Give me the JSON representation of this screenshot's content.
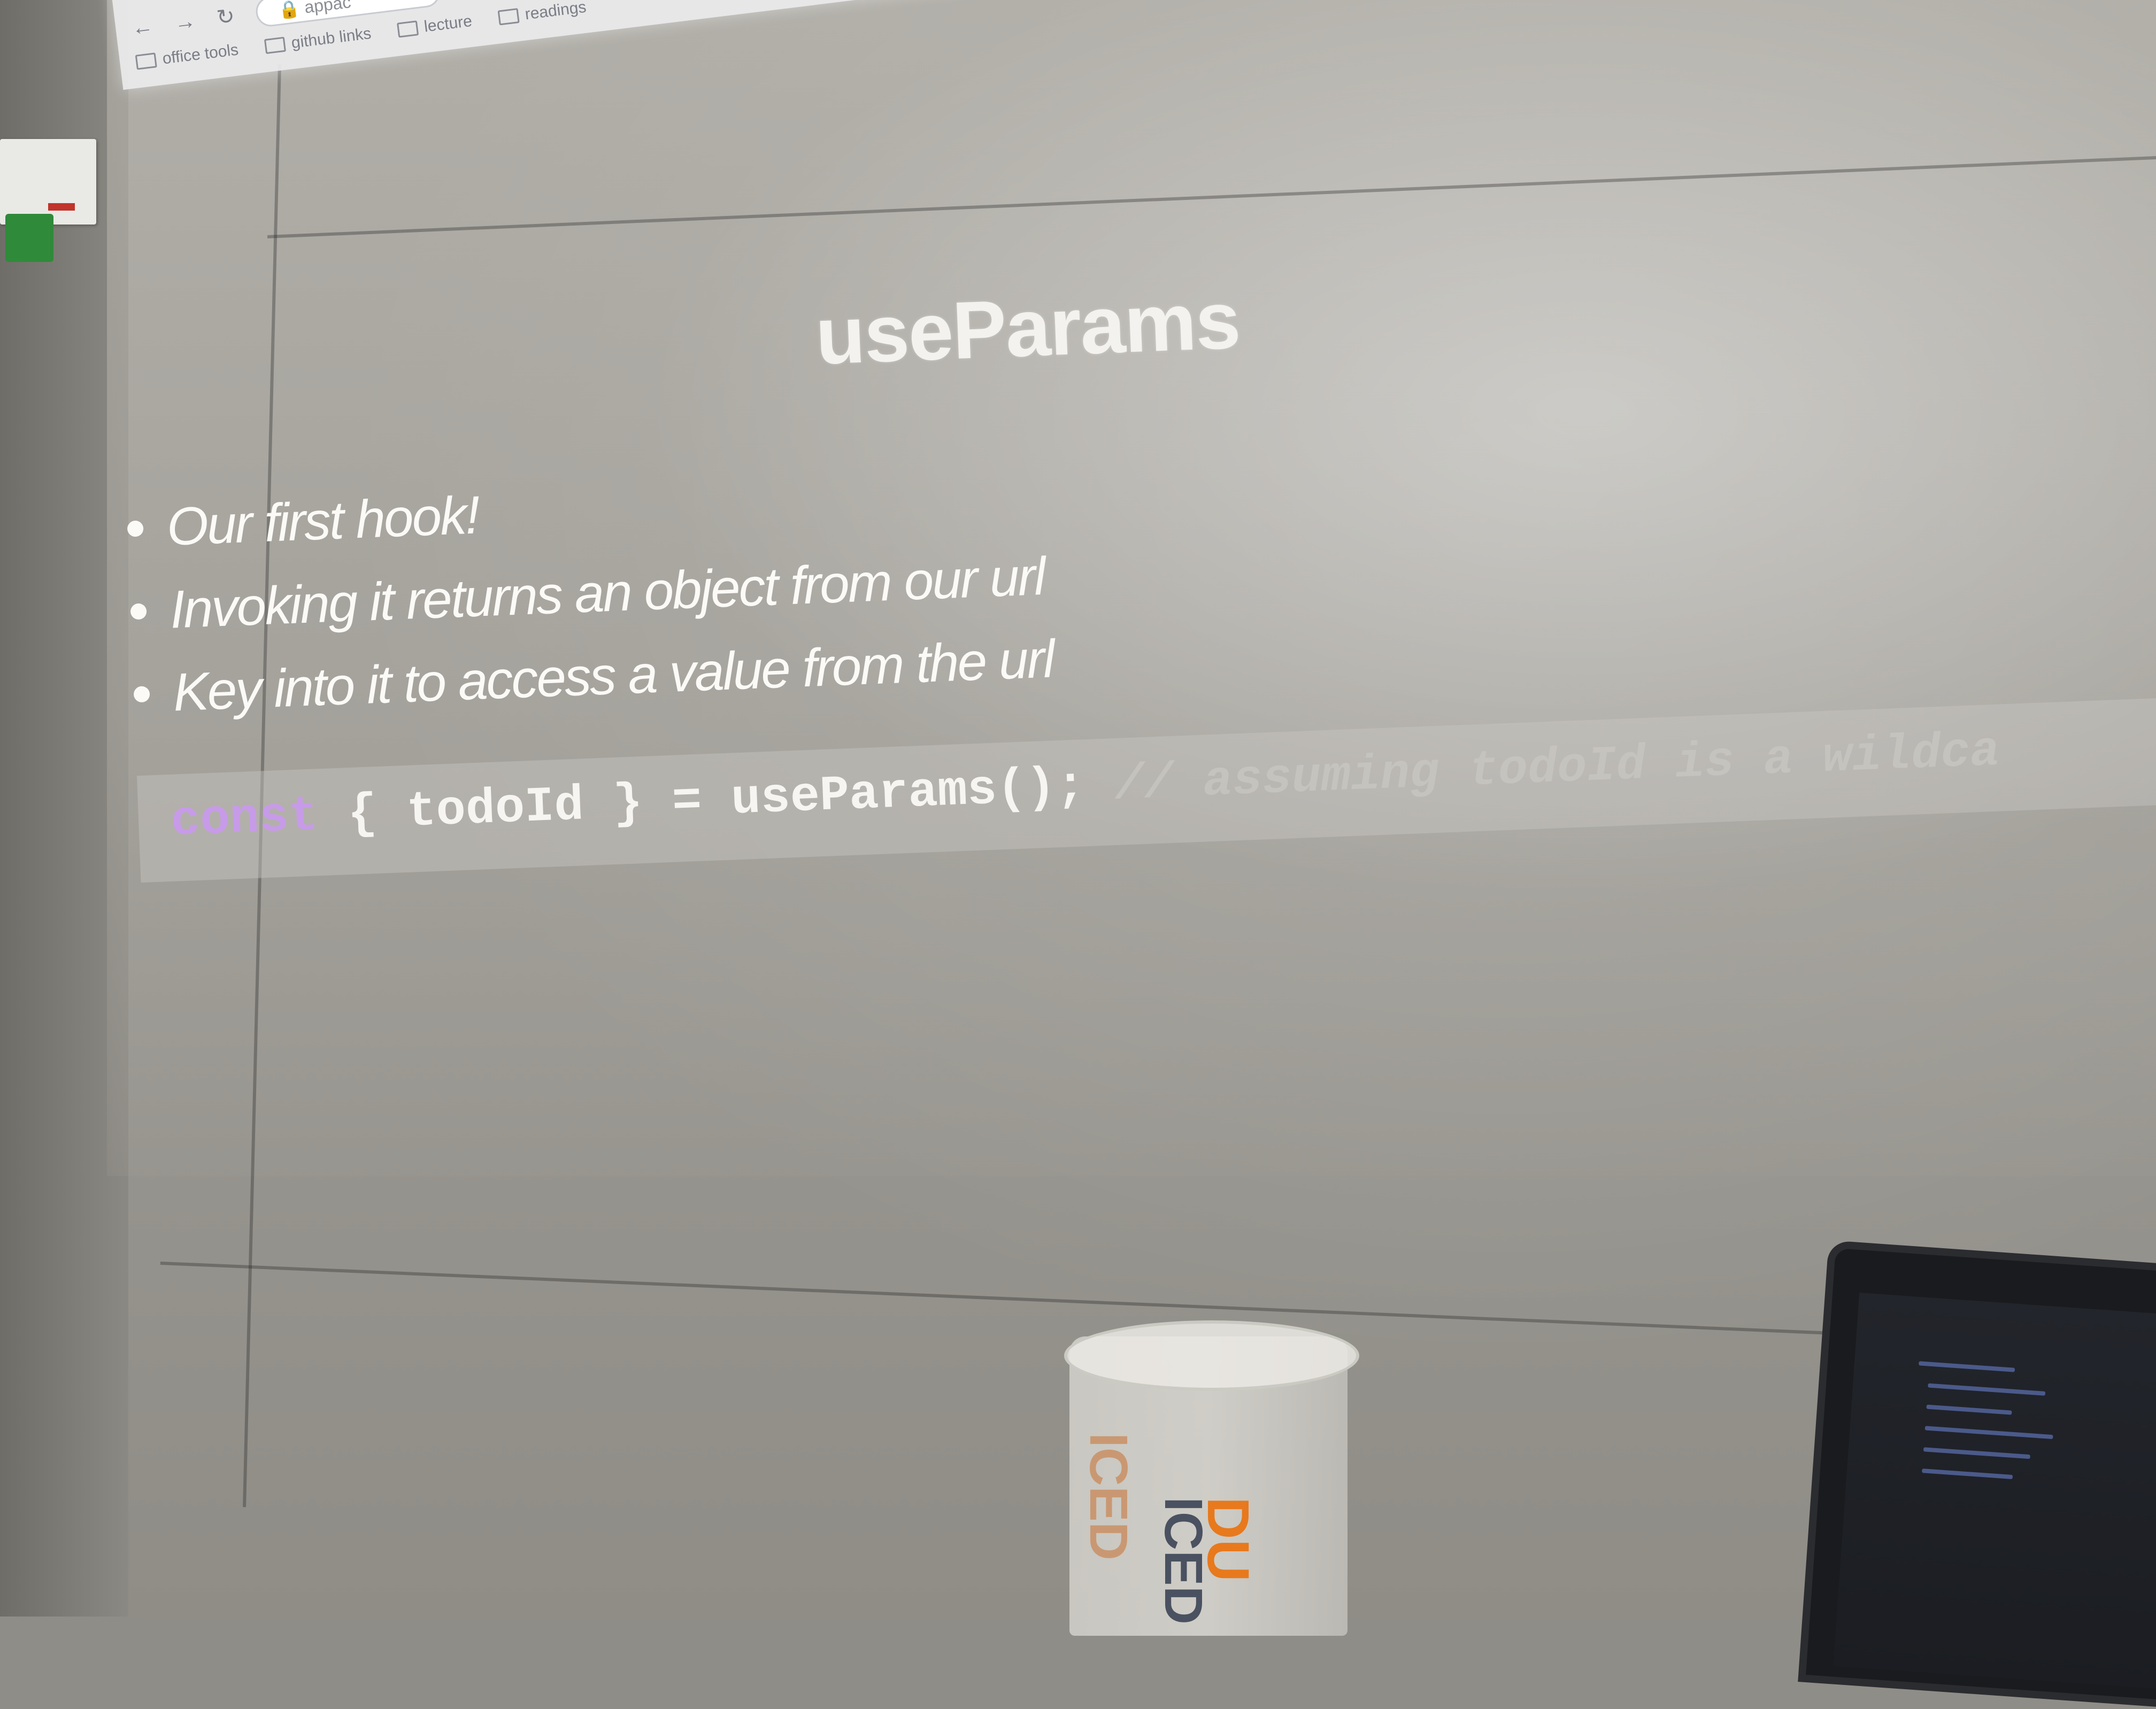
{
  "browser": {
    "address_text": "appac",
    "bookmarks": [
      {
        "label": "office tools"
      },
      {
        "label": "github links"
      },
      {
        "label": "lecture"
      },
      {
        "label": "readings"
      }
    ]
  },
  "slide": {
    "title": "useParams",
    "bullets": [
      "Our first hook!",
      "Invoking it returns an object from our url",
      "Key into it to access a value from the url"
    ],
    "code": {
      "keyword": "const",
      "statement": " { todoId } = useParams(); ",
      "comment": "// assuming todoId is a wildca"
    }
  },
  "cup": {
    "brand_text": "DU",
    "label_front": "ICED",
    "label_back": "ICED"
  },
  "colors": {
    "keyword": "#c79be8",
    "slide_text": "#fbfaf7",
    "cup_orange": "#e8791c"
  }
}
